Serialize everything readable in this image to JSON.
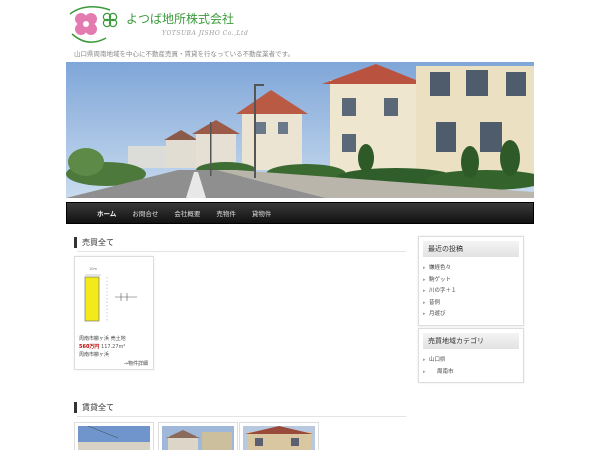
{
  "header": {
    "company_name": "よつば地所株式会社",
    "company_name_en": "YOTSUBA JISHO Co.,Ltd",
    "tagline": "山口県周南地域を中心に不動産売買・賃貸を行なっている不動産業者です。",
    "logo_icon": "clover-logo-icon"
  },
  "nav": {
    "items": [
      {
        "label": "ホーム",
        "active": true
      },
      {
        "label": "お問合せ"
      },
      {
        "label": "会社概要"
      },
      {
        "label": "売物件"
      },
      {
        "label": "貸物件"
      }
    ]
  },
  "sales": {
    "title": "売買全て",
    "listing": {
      "line1": "周南市櫛ヶ浜 売土地",
      "price": "560万円",
      "area": "117.27m²",
      "line3": "周南市櫛ヶ浜",
      "link": "→物件詳細",
      "plot_width_label": "10m"
    }
  },
  "rentals": {
    "title": "賃貸全て"
  },
  "sidebar": {
    "recent": {
      "title": "最近の投稿",
      "items": [
        "嫌経色々",
        "駒ゲット",
        "川の字＋１",
        "昔例",
        "月遊び"
      ]
    },
    "categories": {
      "title": "売買地域カテゴリ",
      "items": [
        "山口県",
        "周南市"
      ]
    }
  },
  "colors": {
    "brand_green": "#3a9a3a",
    "nav_bg": "#1a1a1a",
    "price_red": "#c00000"
  }
}
